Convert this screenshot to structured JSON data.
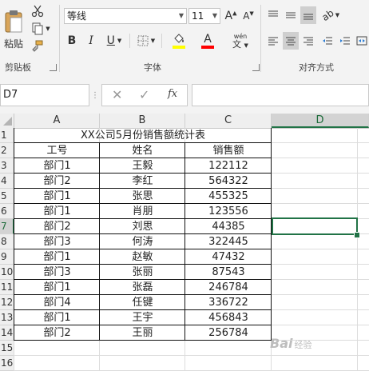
{
  "ribbon": {
    "clipboard": {
      "paste_label": "粘贴",
      "group_label": "剪贴板"
    },
    "font": {
      "name": "等线",
      "size": "11",
      "bold": "B",
      "italic": "I",
      "underline": "U",
      "font_color_glyph": "A",
      "phonetic_glyph": "wén",
      "group_label": "字体",
      "fill_color": "#ffff00",
      "font_color": "#ff0000"
    },
    "alignment": {
      "group_label": "对齐方式"
    }
  },
  "formula_bar": {
    "name_box": "D7",
    "fx_label": "fx",
    "value": ""
  },
  "sheet": {
    "columns": [
      "A",
      "B",
      "C",
      "D"
    ],
    "selected_column": "D",
    "rows": [
      "1",
      "2",
      "3",
      "4",
      "5",
      "6",
      "7",
      "8",
      "9",
      "10",
      "11",
      "12",
      "13",
      "14",
      "15",
      "16"
    ],
    "selected_row": "7",
    "active_cell": "D7",
    "title": "XX公司5月份销售额统计表",
    "headers": [
      "工号",
      "姓名",
      "销售额"
    ],
    "data": [
      [
        "部门1",
        "王毅",
        "122112"
      ],
      [
        "部门2",
        "李红",
        "564322"
      ],
      [
        "部门1",
        "张思",
        "455325"
      ],
      [
        "部门1",
        "肖朋",
        "123556"
      ],
      [
        "部门2",
        "刘思",
        "44385"
      ],
      [
        "部门3",
        "何涛",
        "322445"
      ],
      [
        "部门1",
        "赵敏",
        "47432"
      ],
      [
        "部门3",
        "张丽",
        "87543"
      ],
      [
        "部门1",
        "张磊",
        "246784"
      ],
      [
        "部门4",
        "任键",
        "336722"
      ],
      [
        "部门1",
        "王宇",
        "456843"
      ],
      [
        "部门2",
        "王丽",
        "256784"
      ]
    ]
  },
  "watermark": {
    "text": "Bai",
    "sub": "经验"
  },
  "colors": {
    "excel_green": "#217346"
  }
}
